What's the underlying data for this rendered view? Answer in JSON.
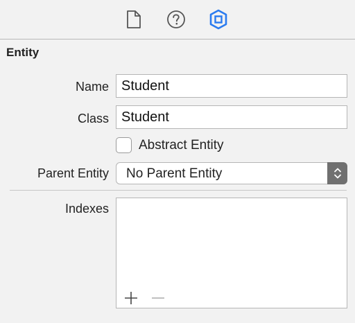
{
  "toolbar": {
    "icons": [
      "file-inspector-icon",
      "quick-help-icon",
      "data-model-inspector-icon"
    ],
    "active_color": "#2a7bf0",
    "inactive_color": "#555555"
  },
  "entity": {
    "section_title": "Entity",
    "name_label": "Name",
    "name_value": "Student",
    "class_label": "Class",
    "class_value": "Student",
    "abstract_label": "Abstract Entity",
    "abstract_checked": false,
    "parent_label": "Parent Entity",
    "parent_value": "No Parent Entity",
    "indexes_label": "Indexes",
    "indexes": []
  }
}
